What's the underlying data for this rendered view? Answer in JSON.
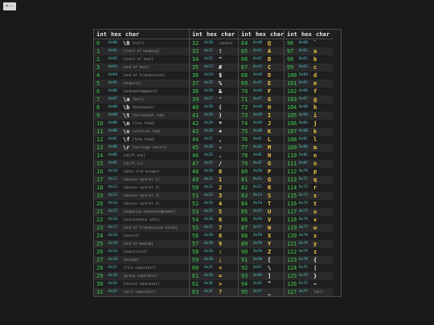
{
  "back_button": {
    "label": "<--"
  },
  "headers": {
    "int": "int",
    "hex": "hex",
    "char": "char"
  },
  "groups": [
    {
      "rows": [
        {
          "i": "0",
          "h": "0x00",
          "c": "\\0",
          "d": "[null]"
        },
        {
          "i": "1",
          "h": "0x01",
          "c": "",
          "d": "[start of heading]"
        },
        {
          "i": "2",
          "h": "0x02",
          "c": "",
          "d": "[start of text]"
        },
        {
          "i": "3",
          "h": "0x03",
          "c": "",
          "d": "[end of text]"
        },
        {
          "i": "4",
          "h": "0x04",
          "c": "",
          "d": "[end of transmission]"
        },
        {
          "i": "5",
          "h": "0x05",
          "c": "",
          "d": "[enquiry]"
        },
        {
          "i": "6",
          "h": "0x06",
          "c": "",
          "d": "[acknowledgement]"
        },
        {
          "i": "7",
          "h": "0x07",
          "c": "\\a",
          "d": "[bell]"
        },
        {
          "i": "8",
          "h": "0x08",
          "c": "\\b",
          "d": "[backspace]"
        },
        {
          "i": "9",
          "h": "0x09",
          "c": "\\t",
          "d": "[horizontal tab]"
        },
        {
          "i": "10",
          "h": "0x0A",
          "c": "\\n",
          "d": "[line feed]"
        },
        {
          "i": "11",
          "h": "0x0B",
          "c": "\\v",
          "d": "[vertical tab]"
        },
        {
          "i": "12",
          "h": "0x0C",
          "c": "\\f",
          "d": "[form feed]"
        },
        {
          "i": "13",
          "h": "0x0D",
          "c": "\\r",
          "d": "[carriage return]"
        },
        {
          "i": "14",
          "h": "0x0E",
          "c": "",
          "d": "[shift out]"
        },
        {
          "i": "15",
          "h": "0x0F",
          "c": "",
          "d": "[shift in]"
        },
        {
          "i": "16",
          "h": "0x10",
          "c": "",
          "d": "[data link escape]"
        },
        {
          "i": "17",
          "h": "0x11",
          "c": "",
          "d": "[device control 1]"
        },
        {
          "i": "18",
          "h": "0x12",
          "c": "",
          "d": "[device control 2]"
        },
        {
          "i": "19",
          "h": "0x13",
          "c": "",
          "d": "[device control 3]"
        },
        {
          "i": "20",
          "h": "0x14",
          "c": "",
          "d": "[device control 4]"
        },
        {
          "i": "21",
          "h": "0x15",
          "c": "",
          "d": "[negative acknowledgement]"
        },
        {
          "i": "22",
          "h": "0x16",
          "c": "",
          "d": "[synchronous idle]"
        },
        {
          "i": "23",
          "h": "0x17",
          "c": "",
          "d": "[end of transmission block]"
        },
        {
          "i": "24",
          "h": "0x18",
          "c": "",
          "d": "[cancel]"
        },
        {
          "i": "25",
          "h": "0x19",
          "c": "",
          "d": "[end of medium]"
        },
        {
          "i": "26",
          "h": "0x1A",
          "c": "",
          "d": "[substitute]"
        },
        {
          "i": "27",
          "h": "0x1B",
          "c": "",
          "d": "[escape]"
        },
        {
          "i": "28",
          "h": "0x1C",
          "c": "",
          "d": "[file separator]"
        },
        {
          "i": "29",
          "h": "0x1D",
          "c": "",
          "d": "[group separator]"
        },
        {
          "i": "30",
          "h": "0x1E",
          "c": "",
          "d": "[record separator]"
        },
        {
          "i": "31",
          "h": "0x1F",
          "c": "",
          "d": "[unit separator]"
        }
      ]
    },
    {
      "rows": [
        {
          "i": "32",
          "h": "0x20",
          "c": "",
          "d": "[space]"
        },
        {
          "i": "33",
          "h": "0x21",
          "c": "!",
          "d": ""
        },
        {
          "i": "34",
          "h": "0x22",
          "c": "\"",
          "d": ""
        },
        {
          "i": "35",
          "h": "0x23",
          "c": "#",
          "d": ""
        },
        {
          "i": "36",
          "h": "0x24",
          "c": "$",
          "d": ""
        },
        {
          "i": "37",
          "h": "0x25",
          "c": "%",
          "d": ""
        },
        {
          "i": "38",
          "h": "0x26",
          "c": "&",
          "d": ""
        },
        {
          "i": "39",
          "h": "0x27",
          "c": "'",
          "d": ""
        },
        {
          "i": "40",
          "h": "0x28",
          "c": "(",
          "d": ""
        },
        {
          "i": "41",
          "h": "0x29",
          "c": ")",
          "d": ""
        },
        {
          "i": "42",
          "h": "0x2A",
          "c": "*",
          "d": ""
        },
        {
          "i": "43",
          "h": "0x2B",
          "c": "+",
          "d": ""
        },
        {
          "i": "44",
          "h": "0x2C",
          "c": ",",
          "d": ""
        },
        {
          "i": "45",
          "h": "0x2D",
          "c": "-",
          "d": ""
        },
        {
          "i": "46",
          "h": "0x2E",
          "c": ".",
          "d": ""
        },
        {
          "i": "47",
          "h": "0x2F",
          "c": "/",
          "d": ""
        },
        {
          "i": "48",
          "h": "0x30",
          "c": "0",
          "d": ""
        },
        {
          "i": "49",
          "h": "0x31",
          "c": "1",
          "d": ""
        },
        {
          "i": "50",
          "h": "0x32",
          "c": "2",
          "d": ""
        },
        {
          "i": "51",
          "h": "0x33",
          "c": "3",
          "d": ""
        },
        {
          "i": "52",
          "h": "0x34",
          "c": "4",
          "d": ""
        },
        {
          "i": "53",
          "h": "0x35",
          "c": "5",
          "d": ""
        },
        {
          "i": "54",
          "h": "0x36",
          "c": "6",
          "d": ""
        },
        {
          "i": "55",
          "h": "0x37",
          "c": "7",
          "d": ""
        },
        {
          "i": "56",
          "h": "0x38",
          "c": "8",
          "d": ""
        },
        {
          "i": "57",
          "h": "0x39",
          "c": "9",
          "d": ""
        },
        {
          "i": "58",
          "h": "0x3A",
          "c": ":",
          "d": ""
        },
        {
          "i": "59",
          "h": "0x3B",
          "c": ";",
          "d": ""
        },
        {
          "i": "60",
          "h": "0x3C",
          "c": "<",
          "d": ""
        },
        {
          "i": "61",
          "h": "0x3D",
          "c": "=",
          "d": ""
        },
        {
          "i": "62",
          "h": "0x3E",
          "c": ">",
          "d": ""
        },
        {
          "i": "63",
          "h": "0x3F",
          "c": "?",
          "d": ""
        }
      ]
    },
    {
      "rows": [
        {
          "i": "64",
          "h": "0x40",
          "c": "@",
          "d": ""
        },
        {
          "i": "65",
          "h": "0x41",
          "c": "A",
          "d": ""
        },
        {
          "i": "66",
          "h": "0x42",
          "c": "B",
          "d": ""
        },
        {
          "i": "67",
          "h": "0x43",
          "c": "C",
          "d": ""
        },
        {
          "i": "68",
          "h": "0x44",
          "c": "D",
          "d": ""
        },
        {
          "i": "69",
          "h": "0x45",
          "c": "E",
          "d": ""
        },
        {
          "i": "70",
          "h": "0x46",
          "c": "F",
          "d": ""
        },
        {
          "i": "71",
          "h": "0x47",
          "c": "G",
          "d": ""
        },
        {
          "i": "72",
          "h": "0x48",
          "c": "H",
          "d": ""
        },
        {
          "i": "73",
          "h": "0x49",
          "c": "I",
          "d": ""
        },
        {
          "i": "74",
          "h": "0x4A",
          "c": "J",
          "d": ""
        },
        {
          "i": "75",
          "h": "0x4B",
          "c": "K",
          "d": ""
        },
        {
          "i": "76",
          "h": "0x4C",
          "c": "L",
          "d": ""
        },
        {
          "i": "77",
          "h": "0x4D",
          "c": "M",
          "d": ""
        },
        {
          "i": "78",
          "h": "0x4E",
          "c": "N",
          "d": ""
        },
        {
          "i": "79",
          "h": "0x4F",
          "c": "O",
          "d": ""
        },
        {
          "i": "80",
          "h": "0x50",
          "c": "P",
          "d": ""
        },
        {
          "i": "81",
          "h": "0x51",
          "c": "Q",
          "d": ""
        },
        {
          "i": "82",
          "h": "0x52",
          "c": "R",
          "d": ""
        },
        {
          "i": "83",
          "h": "0x53",
          "c": "S",
          "d": ""
        },
        {
          "i": "84",
          "h": "0x54",
          "c": "T",
          "d": ""
        },
        {
          "i": "85",
          "h": "0x55",
          "c": "U",
          "d": ""
        },
        {
          "i": "86",
          "h": "0x56",
          "c": "V",
          "d": ""
        },
        {
          "i": "87",
          "h": "0x57",
          "c": "W",
          "d": ""
        },
        {
          "i": "88",
          "h": "0x58",
          "c": "X",
          "d": ""
        },
        {
          "i": "89",
          "h": "0x59",
          "c": "Y",
          "d": ""
        },
        {
          "i": "90",
          "h": "0x5A",
          "c": "Z",
          "d": ""
        },
        {
          "i": "91",
          "h": "0x5B",
          "c": "[",
          "d": ""
        },
        {
          "i": "92",
          "h": "0x5C",
          "c": "\\",
          "d": ""
        },
        {
          "i": "93",
          "h": "0x5D",
          "c": "]",
          "d": ""
        },
        {
          "i": "94",
          "h": "0x5E",
          "c": "^",
          "d": ""
        },
        {
          "i": "95",
          "h": "0x5F",
          "c": "_",
          "d": ""
        }
      ]
    },
    {
      "rows": [
        {
          "i": "96",
          "h": "0x60",
          "c": "`",
          "d": ""
        },
        {
          "i": "97",
          "h": "0x61",
          "c": "a",
          "d": ""
        },
        {
          "i": "98",
          "h": "0x62",
          "c": "b",
          "d": ""
        },
        {
          "i": "99",
          "h": "0x63",
          "c": "c",
          "d": ""
        },
        {
          "i": "100",
          "h": "0x64",
          "c": "d",
          "d": ""
        },
        {
          "i": "101",
          "h": "0x65",
          "c": "e",
          "d": ""
        },
        {
          "i": "102",
          "h": "0x66",
          "c": "f",
          "d": ""
        },
        {
          "i": "103",
          "h": "0x67",
          "c": "g",
          "d": ""
        },
        {
          "i": "104",
          "h": "0x68",
          "c": "h",
          "d": ""
        },
        {
          "i": "105",
          "h": "0x69",
          "c": "i",
          "d": ""
        },
        {
          "i": "106",
          "h": "0x6A",
          "c": "j",
          "d": ""
        },
        {
          "i": "107",
          "h": "0x6B",
          "c": "k",
          "d": ""
        },
        {
          "i": "108",
          "h": "0x6C",
          "c": "l",
          "d": ""
        },
        {
          "i": "109",
          "h": "0x6D",
          "c": "m",
          "d": ""
        },
        {
          "i": "110",
          "h": "0x6E",
          "c": "n",
          "d": ""
        },
        {
          "i": "111",
          "h": "0x6F",
          "c": "o",
          "d": ""
        },
        {
          "i": "112",
          "h": "0x70",
          "c": "p",
          "d": ""
        },
        {
          "i": "113",
          "h": "0x71",
          "c": "q",
          "d": ""
        },
        {
          "i": "114",
          "h": "0x72",
          "c": "r",
          "d": ""
        },
        {
          "i": "115",
          "h": "0x73",
          "c": "s",
          "d": ""
        },
        {
          "i": "116",
          "h": "0x74",
          "c": "t",
          "d": ""
        },
        {
          "i": "117",
          "h": "0x75",
          "c": "u",
          "d": ""
        },
        {
          "i": "118",
          "h": "0x76",
          "c": "v",
          "d": ""
        },
        {
          "i": "119",
          "h": "0x77",
          "c": "w",
          "d": ""
        },
        {
          "i": "120",
          "h": "0x78",
          "c": "x",
          "d": ""
        },
        {
          "i": "121",
          "h": "0x79",
          "c": "y",
          "d": ""
        },
        {
          "i": "122",
          "h": "0x7A",
          "c": "z",
          "d": ""
        },
        {
          "i": "123",
          "h": "0x7B",
          "c": "{",
          "d": ""
        },
        {
          "i": "124",
          "h": "0x7C",
          "c": "|",
          "d": ""
        },
        {
          "i": "125",
          "h": "0x7D",
          "c": "}",
          "d": ""
        },
        {
          "i": "126",
          "h": "0x7E",
          "c": "~",
          "d": ""
        },
        {
          "i": "127",
          "h": "0x7F",
          "c": "",
          "d": "[del]"
        }
      ]
    }
  ]
}
